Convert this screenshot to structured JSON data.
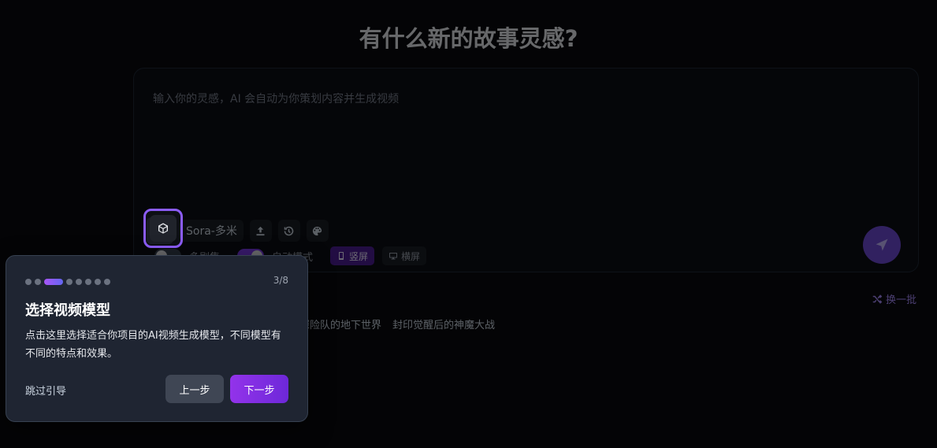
{
  "headline": "有什么新的故事灵感?",
  "composer": {
    "placeholder": "输入你的灵感，AI 会自动为你策划内容并生成视频",
    "model_label": "Sora-多米",
    "options": {
      "multi_episode_label": "多剧集",
      "auto_mode_label": "自动模式",
      "portrait_label": "竖屏",
      "landscape_label": "横屏"
    }
  },
  "suggestions": {
    "refresh_label": "换一批",
    "items": [
      "探险队的地下世界",
      "封印觉醒后的神魔大战"
    ]
  },
  "guide": {
    "step_counter": "3/8",
    "total_steps": 8,
    "current_step": 3,
    "title": "选择视频模型",
    "description": "点击这里选择适合你项目的AI视频生成模型，不同模型有不同的特点和效果。",
    "skip_label": "跳过引导",
    "prev_label": "上一步",
    "next_label": "下一步"
  },
  "colors": {
    "accent": "#8b5cf6",
    "background": "#0a0b0f",
    "panel": "#1f2532"
  }
}
